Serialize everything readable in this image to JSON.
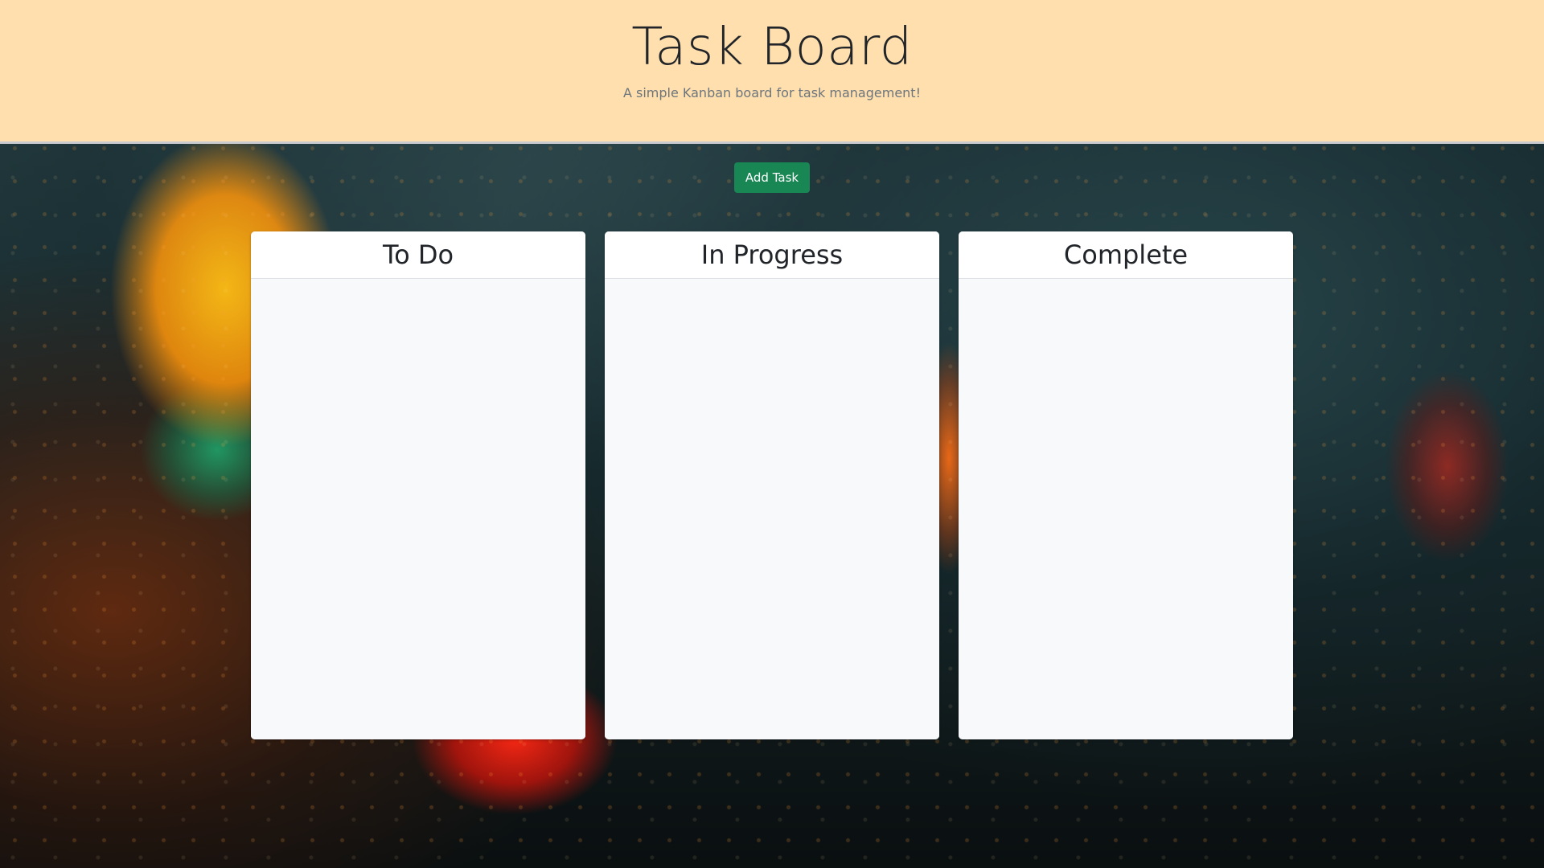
{
  "header": {
    "title": "Task Board",
    "subtitle": "A simple Kanban board for task management!",
    "background_color": "#ffdfad"
  },
  "actions": {
    "add_task_label": "Add Task",
    "add_task_color": "#198754"
  },
  "lanes": [
    {
      "title": "To Do",
      "tasks": []
    },
    {
      "title": "In Progress",
      "tasks": []
    },
    {
      "title": "Complete",
      "tasks": []
    }
  ]
}
